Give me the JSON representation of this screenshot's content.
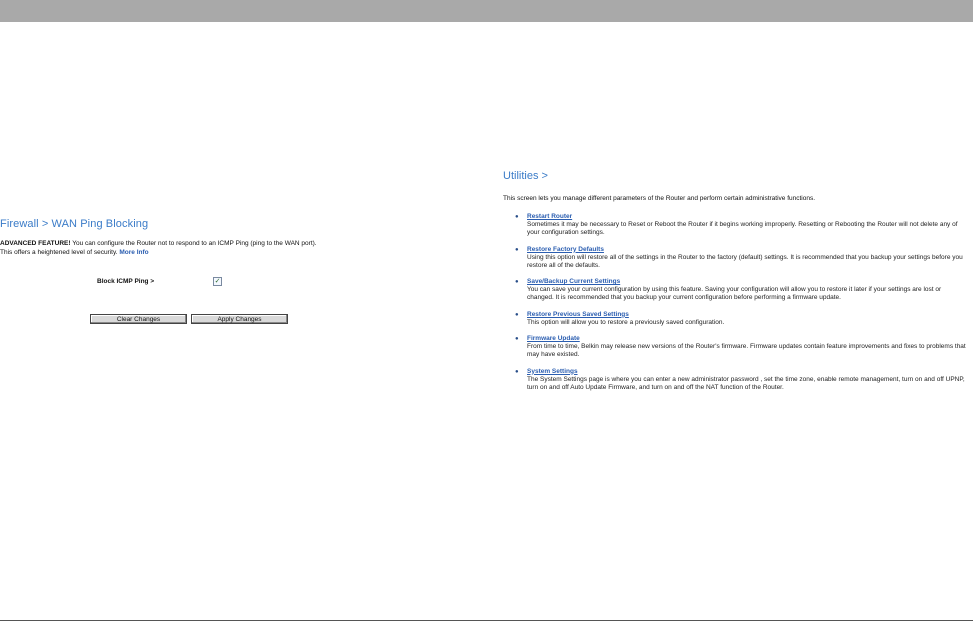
{
  "firewall": {
    "title": "Firewall > WAN Ping Blocking",
    "advanced_label": "ADVANCED FEATURE!",
    "description_line1": " You can configure the Router not to respond to an ICMP Ping (ping to the WAN port).",
    "description_line2": "This offers a heightened level of security. ",
    "more_info": "More Info",
    "block_label": "Block ICMP Ping >",
    "block_checked": true,
    "clear_button": "Clear Changes",
    "apply_button": "Apply Changes"
  },
  "utilities": {
    "title": "Utilities >",
    "intro": "This screen lets you manage different parameters of the Router and perform certain administrative functions.",
    "items": [
      {
        "title": "Restart Router",
        "desc": "Sometimes it may be necessary to Reset or Reboot the Router if it begins working improperly. Resetting or Rebooting the Router will not delete any of your configuration settings."
      },
      {
        "title": "Restore Factory Defaults",
        "desc": "Using this option will restore all of the settings in the Router to the factory (default) settings. It is recommended that you backup your settings before you restore all of the defaults."
      },
      {
        "title": "Save/Backup Current Settings",
        "desc": "You can save your current configuration by using this feature. Saving your configuration will allow you to restore it later if your settings are lost or changed. It is recommended that you backup your current configuration before performing a firmware update."
      },
      {
        "title": "Restore Previous Saved Settings",
        "desc": "This option will allow you to restore a previously saved configuration."
      },
      {
        "title": "Firmware Update",
        "desc": "From time to time, Belkin may release new versions of the Router's firmware. Firmware updates contain feature improvements and fixes to problems that may have existed."
      },
      {
        "title": "System Settings",
        "desc": "The System Settings page is where you can enter a new administrator password , set the time zone, enable remote management, turn on and off UPNP, turn on and off Auto Update Firmware, and turn on and off the NAT function of the Router."
      }
    ]
  }
}
